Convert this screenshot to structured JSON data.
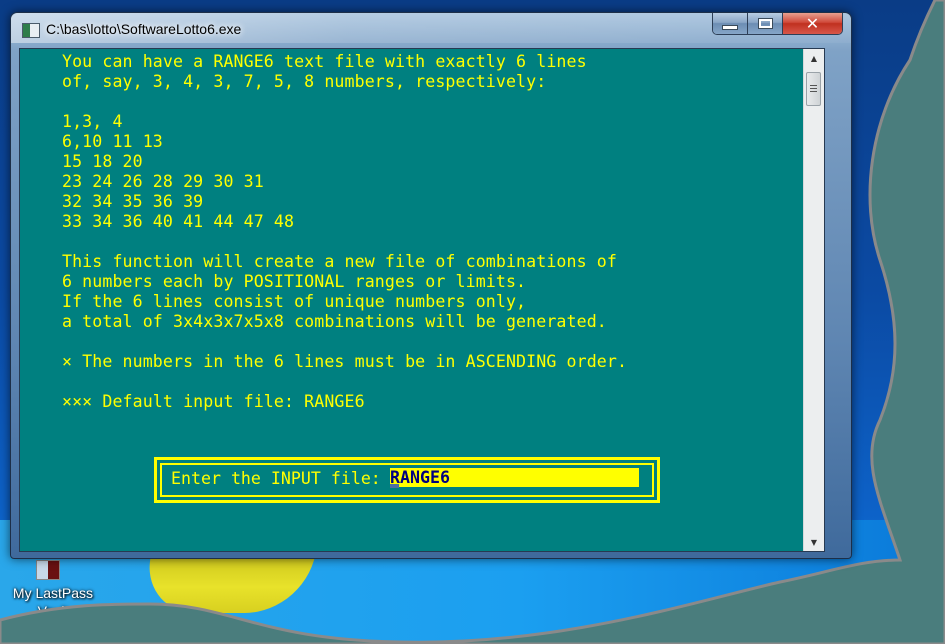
{
  "window": {
    "title": "C:\\bas\\lotto\\SoftwareLotto6.exe",
    "caption_buttons": {
      "minimize_icon": "minimize-icon",
      "maximize_icon": "maximize-icon",
      "close_icon": "close-icon",
      "close_glyph": "✕"
    }
  },
  "console": {
    "text_color": "#ffff00",
    "background_color": "#008080",
    "lines": [
      "You can have a RANGE6 text file with exactly 6 lines",
      "of, say, 3, 4, 3, 7, 5, 8 numbers, respectively:",
      "",
      "1,3, 4",
      "6,10 11 13",
      "15 18 20",
      "23 24 26 28 29 30 31",
      "32 34 35 36 39",
      "33 34 36 40 41 44 47 48",
      "",
      "This function will create a new file of combinations of",
      "6 numbers each by POSITIONAL ranges or limits.",
      "If the 6 lines consist of unique numbers only,",
      "a total of 3x4x3x7x5x8 combinations will be generated.",
      "",
      "× The numbers in the 6 lines must be in ASCENDING order.",
      "",
      "××× Default input file: RANGE6"
    ]
  },
  "prompt": {
    "label": "Enter the INPUT file:",
    "value": "RANGE6"
  },
  "scrollbar": {
    "up_arrow": "▲",
    "down_arrow": "▼"
  },
  "desktop": {
    "icons": [
      {
        "label": "My LastPass",
        "label_line2": "Vault"
      }
    ]
  }
}
